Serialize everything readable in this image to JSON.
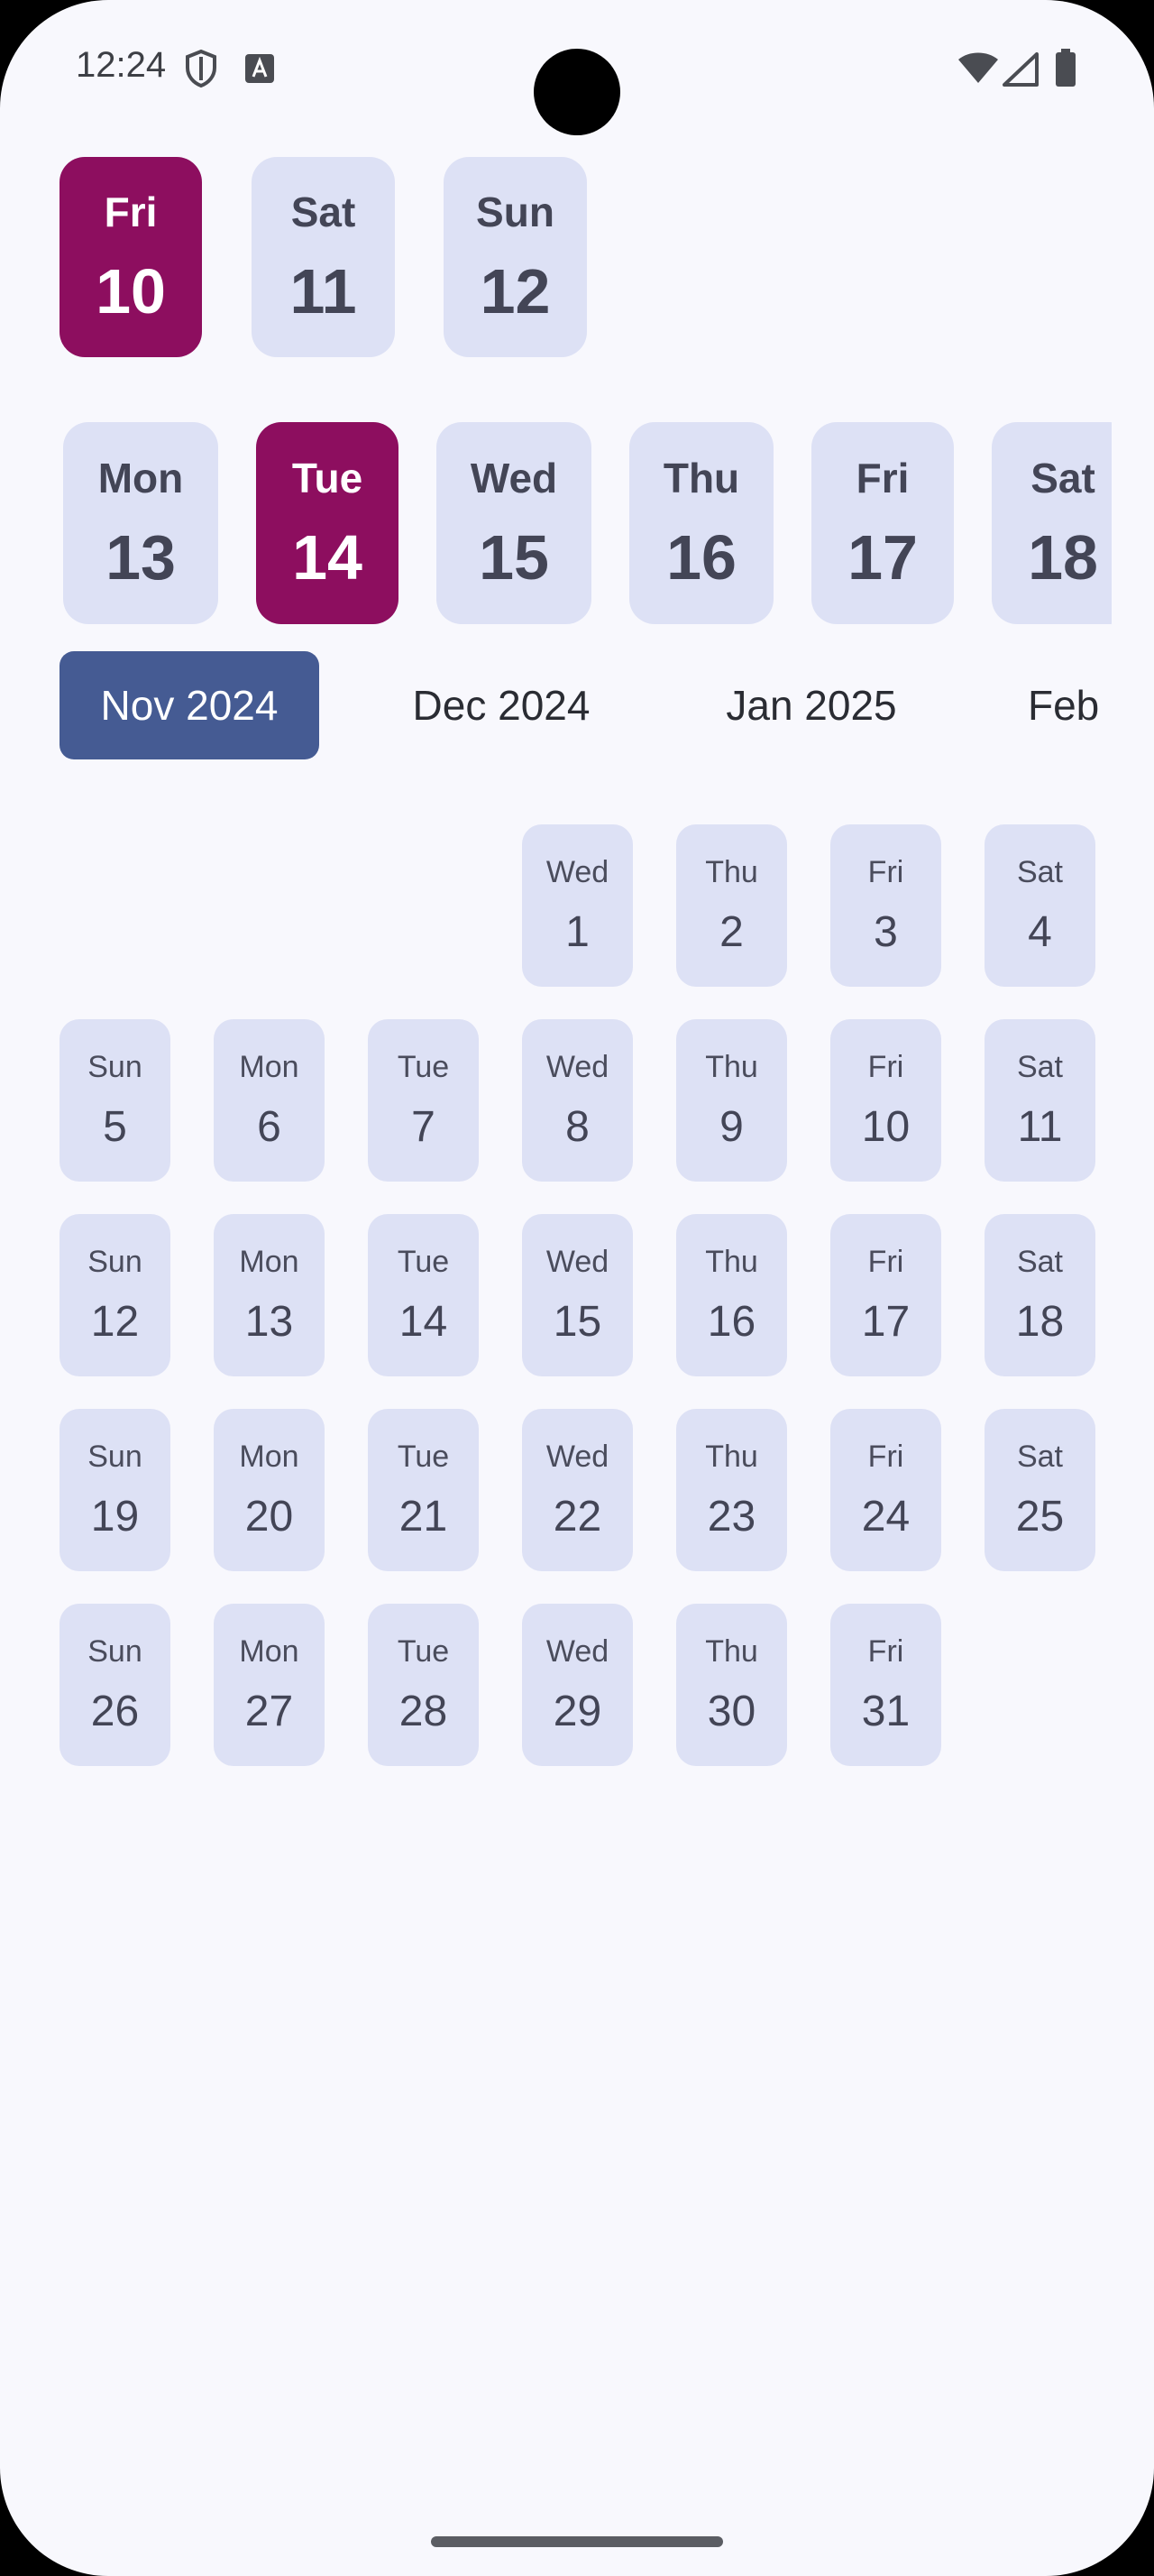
{
  "status_bar": {
    "time": "12:24",
    "icons": [
      "shield-icon",
      "a-font-icon",
      "wifi-icon",
      "signal-icon",
      "battery-icon"
    ]
  },
  "colors": {
    "background": "#f8f8fd",
    "chip": "#dde1f5",
    "chip_text": "#434556",
    "selected_day": "#8d0e5f",
    "selected_month": "#455b93"
  },
  "week_strip_1": {
    "days": [
      {
        "name": "Fri",
        "num": "10",
        "selected": true
      },
      {
        "name": "Sat",
        "num": "11",
        "selected": false
      },
      {
        "name": "Sun",
        "num": "12",
        "selected": false
      }
    ]
  },
  "week_strip_2": {
    "days": [
      {
        "name": "Mon",
        "num": "13",
        "selected": false
      },
      {
        "name": "Tue",
        "num": "14",
        "selected": true
      },
      {
        "name": "Wed",
        "num": "15",
        "selected": false
      },
      {
        "name": "Thu",
        "num": "16",
        "selected": false
      },
      {
        "name": "Fri",
        "num": "17",
        "selected": false
      },
      {
        "name": "Sat",
        "num": "18",
        "selected": false
      }
    ]
  },
  "months": {
    "items": [
      {
        "label": "Nov 2024",
        "active": true
      },
      {
        "label": "Dec 2024",
        "active": false
      },
      {
        "label": "Jan 2025",
        "active": false
      },
      {
        "label": "Feb",
        "active": false
      }
    ]
  },
  "calendar": {
    "days": [
      {
        "name": "Wed",
        "num": "1"
      },
      {
        "name": "Thu",
        "num": "2"
      },
      {
        "name": "Fri",
        "num": "3"
      },
      {
        "name": "Sat",
        "num": "4"
      },
      {
        "name": "Sun",
        "num": "5"
      },
      {
        "name": "Mon",
        "num": "6"
      },
      {
        "name": "Tue",
        "num": "7"
      },
      {
        "name": "Wed",
        "num": "8"
      },
      {
        "name": "Thu",
        "num": "9"
      },
      {
        "name": "Fri",
        "num": "10"
      },
      {
        "name": "Sat",
        "num": "11"
      },
      {
        "name": "Sun",
        "num": "12"
      },
      {
        "name": "Mon",
        "num": "13"
      },
      {
        "name": "Tue",
        "num": "14"
      },
      {
        "name": "Wed",
        "num": "15"
      },
      {
        "name": "Thu",
        "num": "16"
      },
      {
        "name": "Fri",
        "num": "17"
      },
      {
        "name": "Sat",
        "num": "18"
      },
      {
        "name": "Sun",
        "num": "19"
      },
      {
        "name": "Mon",
        "num": "20"
      },
      {
        "name": "Tue",
        "num": "21"
      },
      {
        "name": "Wed",
        "num": "22"
      },
      {
        "name": "Thu",
        "num": "23"
      },
      {
        "name": "Fri",
        "num": "24"
      },
      {
        "name": "Sat",
        "num": "25"
      },
      {
        "name": "Sun",
        "num": "26"
      },
      {
        "name": "Mon",
        "num": "27"
      },
      {
        "name": "Tue",
        "num": "28"
      },
      {
        "name": "Wed",
        "num": "29"
      },
      {
        "name": "Thu",
        "num": "30"
      },
      {
        "name": "Fri",
        "num": "31"
      }
    ]
  }
}
